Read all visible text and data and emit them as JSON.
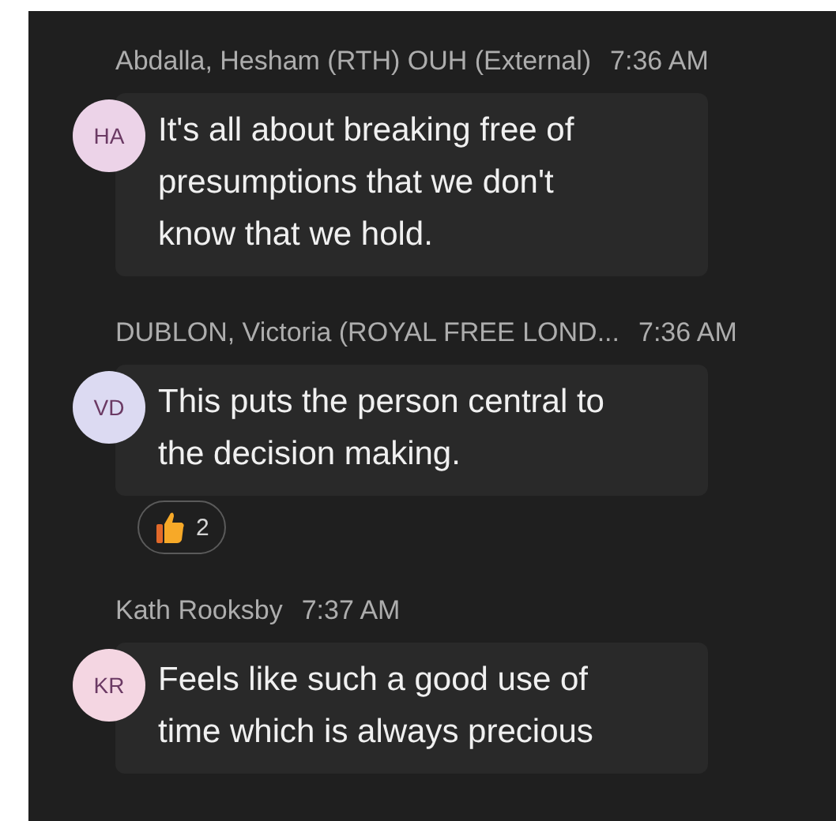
{
  "messages": [
    {
      "author": "Abdalla, Hesham (RTH) OUH (External)",
      "time": "7:36 AM",
      "initials": "HA",
      "color": "#ecd3e8",
      "text": "It's all about breaking free of presumptions that we don't know that we hold."
    },
    {
      "author": "DUBLON, Victoria (ROYAL FREE LOND...",
      "time": "7:36 AM",
      "initials": "VD",
      "color": "#dcdaf2",
      "text": "This puts the person central to the decision making.",
      "reactions": [
        {
          "kind": "thumbs-up",
          "count": "2"
        }
      ]
    },
    {
      "author": "Kath Rooksby",
      "time": "7:37 AM",
      "initials": "KR",
      "color": "#f4d6e2",
      "text": "Feels like such a good use of time which is always precious"
    }
  ]
}
